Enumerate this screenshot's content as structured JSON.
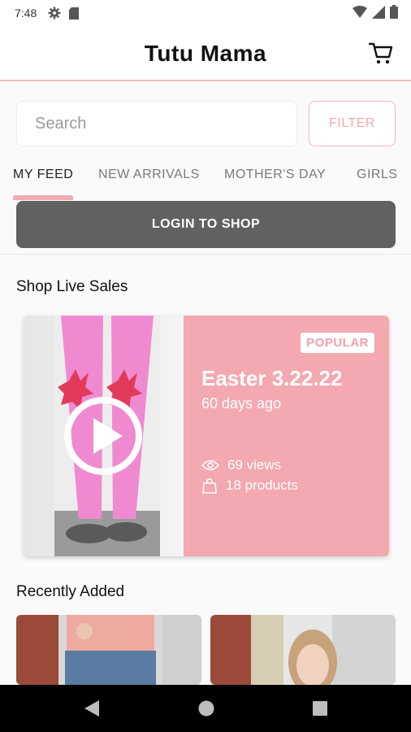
{
  "status_bar": {
    "time": "7:48",
    "icons_left": [
      "gear-icon",
      "sd-card-icon"
    ],
    "icons_right": [
      "wifi-icon",
      "signal-icon",
      "battery-icon"
    ]
  },
  "header": {
    "title": "Tutu Mama",
    "cart_icon": "cart-icon"
  },
  "search": {
    "placeholder": "Search",
    "value": ""
  },
  "filter": {
    "label": "FILTER"
  },
  "tabs": [
    {
      "label": "MY FEED",
      "active": true
    },
    {
      "label": "NEW ARRIVALS",
      "active": false
    },
    {
      "label": "MOTHER'S DAY",
      "active": false
    },
    {
      "label": "GIRLS",
      "active": false
    }
  ],
  "login": {
    "label": "LOGIN TO SHOP"
  },
  "live_sales": {
    "heading": "Shop Live Sales",
    "card": {
      "badge": "POPULAR",
      "title": "Easter 3.22.22",
      "time_ago": "60 days ago",
      "views": "69 views",
      "products": "18 products",
      "play_icon": "play-icon"
    }
  },
  "recently_added": {
    "heading": "Recently Added"
  },
  "nav": {
    "back": "back-icon",
    "home": "home-icon",
    "recents": "recents-icon"
  },
  "colors": {
    "accent": "#f4a8b0",
    "button_dark": "#616161",
    "header_border": "#f3b8bf"
  }
}
